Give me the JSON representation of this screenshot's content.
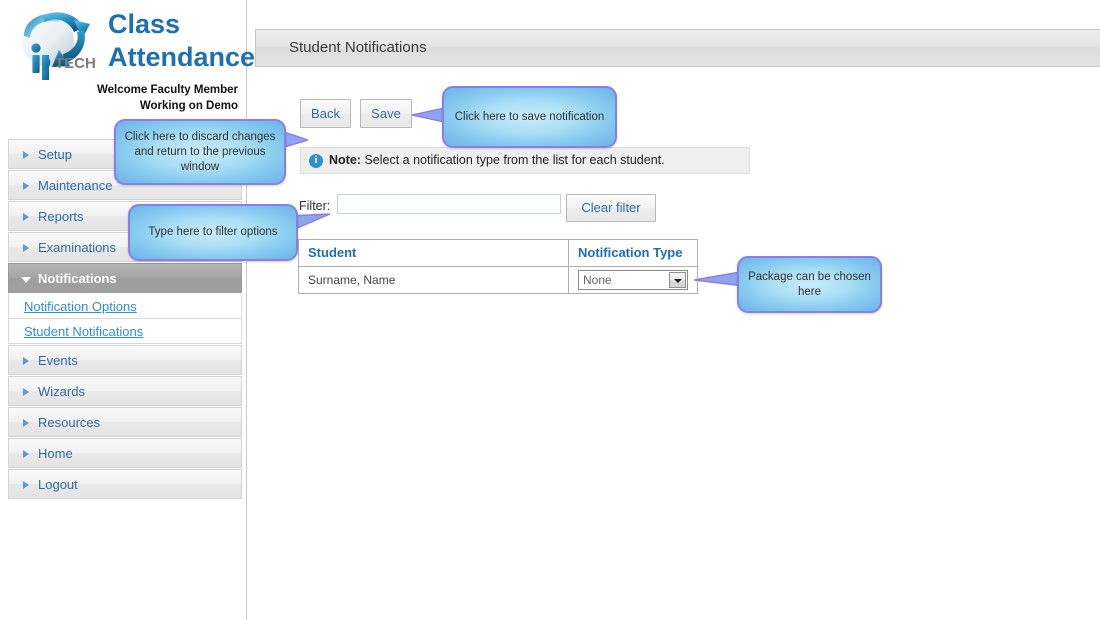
{
  "brand": {
    "logo_icon": "iptech-circular-arrow-logo",
    "logo_text": "TECH",
    "title_line1": "Class",
    "title_line2": "Attendance",
    "welcome_line1": "Welcome Faculty Member",
    "welcome_line2": "Working on Demo",
    "title_color": "#1F6FB2"
  },
  "sidebar": {
    "items": [
      {
        "label": "Setup",
        "state": "collapsed",
        "icon": "chevron-right-icon"
      },
      {
        "label": "Maintenance",
        "state": "collapsed",
        "icon": "chevron-right-icon"
      },
      {
        "label": "Reports",
        "state": "collapsed",
        "icon": "chevron-right-icon"
      },
      {
        "label": "Examinations",
        "state": "collapsed",
        "icon": "chevron-right-icon"
      },
      {
        "label": "Notifications",
        "state": "expanded",
        "icon": "chevron-down-icon"
      },
      {
        "label": "Events",
        "state": "collapsed",
        "icon": "chevron-right-icon"
      },
      {
        "label": "Wizards",
        "state": "collapsed",
        "icon": "chevron-right-icon"
      },
      {
        "label": "Resources",
        "state": "collapsed",
        "icon": "chevron-right-icon"
      },
      {
        "label": "Home",
        "state": "collapsed",
        "icon": "chevron-right-icon"
      },
      {
        "label": "Logout",
        "state": "collapsed",
        "icon": "chevron-right-icon"
      }
    ],
    "sub_items": [
      {
        "label": "Notification Options"
      },
      {
        "label": "Student Notifications"
      }
    ],
    "active_item_label": "Notifications",
    "active_bg": "#a6a6a6",
    "link_color": "#2f8fd0"
  },
  "header": {
    "title": "Student Notifications"
  },
  "toolbar": {
    "back_label": "Back",
    "save_label": "Save"
  },
  "note": {
    "icon": "info-icon",
    "icon_glyph": "i",
    "prefix": "Note:",
    "text": "Select a notification type from the list for each student."
  },
  "filter": {
    "label": "Filter:",
    "value": "",
    "placeholder": "",
    "clear_label": "Clear filter"
  },
  "table": {
    "columns": [
      "Student",
      "Notification Type"
    ],
    "rows": [
      {
        "student": "Surname, Name",
        "notification_type": "None"
      }
    ],
    "header_color": "#1F6FB2"
  },
  "callouts": [
    {
      "id": "back-callout",
      "text": "Click here to discard changes and return to the previous window",
      "points_to": "back-button",
      "tail_side": "right"
    },
    {
      "id": "save-callout",
      "text": "Click here to save notification",
      "points_to": "save-button",
      "tail_side": "left"
    },
    {
      "id": "filter-callout",
      "text": "Type here to filter options",
      "points_to": "filter-input",
      "tail_side": "right"
    },
    {
      "id": "package-callout",
      "text": "Package can be chosen here",
      "points_to": "notification-type-select",
      "tail_side": "left"
    }
  ],
  "theme": {
    "callout_border": "#8A7FE6",
    "callout_fill": "#8ccef0",
    "accent_blue": "#2E6DA4",
    "info_blue": "#2f8fd0"
  }
}
